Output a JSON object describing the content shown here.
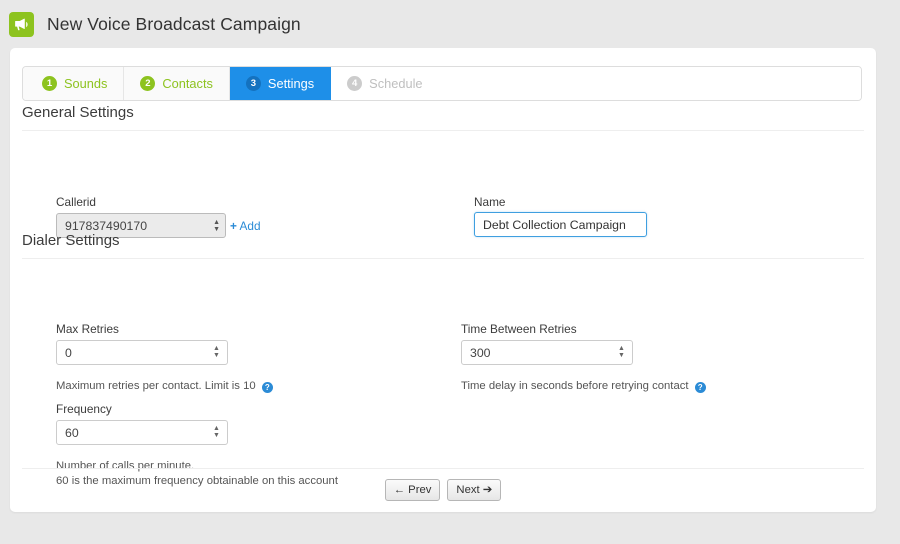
{
  "header": {
    "title": "New Voice Broadcast Campaign",
    "icon": "megaphone-icon",
    "icon_bg": "#8dc31f"
  },
  "colors": {
    "brand_green": "#8dc31f",
    "active_blue": "#1e8fe8",
    "link_blue": "#2b8bd6",
    "page_bg": "#e8e8e8",
    "card_bg": "#ffffff"
  },
  "tabs": [
    {
      "number": "1",
      "label": "Sounds",
      "state": "done"
    },
    {
      "number": "2",
      "label": "Contacts",
      "state": "done"
    },
    {
      "number": "3",
      "label": "Settings",
      "state": "active"
    },
    {
      "number": "4",
      "label": "Schedule",
      "state": "disabled"
    }
  ],
  "general_settings": {
    "heading": "General Settings",
    "callerid": {
      "label": "Callerid",
      "value": "917837490170",
      "options": [
        "917837490170"
      ],
      "add_link": "Add",
      "add_plus": "+"
    },
    "name": {
      "label": "Name",
      "value": "Debt Collection Campaign",
      "placeholder": "",
      "focused": true
    }
  },
  "dialer_settings": {
    "heading": "Dialer Settings",
    "max_retries": {
      "label": "Max Retries",
      "value": "0",
      "help": "Maximum retries per contact. Limit is 10",
      "help_icon": "question-circle-icon"
    },
    "time_between_retries": {
      "label": "Time Between Retries",
      "value": "300",
      "help": "Time delay in seconds before retrying contact",
      "help_icon": "question-circle-icon"
    },
    "frequency": {
      "label": "Frequency",
      "value": "60",
      "help_line1": "Number of calls per minute.",
      "help_line2": "60 is the maximum frequency obtainable on this account"
    }
  },
  "footer": {
    "prev_label": "Prev",
    "prev_icon": "arrow-left-icon",
    "next_label": "Next",
    "next_icon": "arrow-right-icon"
  }
}
